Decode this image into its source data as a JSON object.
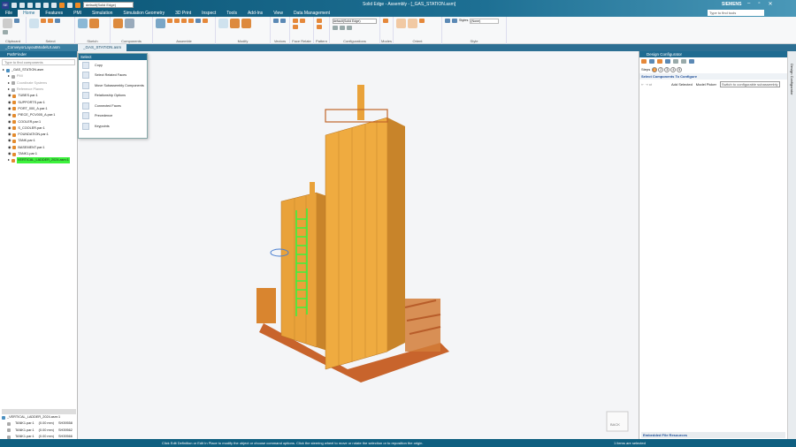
{
  "app": {
    "title": "Solid Edge - Assembly - [_GAS_STATION.asm]",
    "brand": "SIEMENS",
    "logo": "SE",
    "style_select": "default(Solid Edge)",
    "find_placeholder": "Type to find tools"
  },
  "menu_tabs": [
    "File",
    "Home",
    "Features",
    "PMI",
    "Simulation",
    "Simulation Geometry",
    "3D Print",
    "Inspect",
    "Tools",
    "Add-Ins",
    "View",
    "Data Management"
  ],
  "ribbon": {
    "groups": [
      {
        "label": "Clipboard",
        "buttons": [
          "Paste"
        ]
      },
      {
        "label": "Select",
        "buttons": [
          "Select"
        ]
      },
      {
        "label": "Sketch",
        "buttons": [
          "Sketch",
          "3D Sketch"
        ]
      },
      {
        "label": "Components",
        "buttons": [
          "Insert Component",
          "Create Part In-Place"
        ]
      },
      {
        "label": "Assemble",
        "buttons": [
          "Assemble"
        ]
      },
      {
        "label": "Modify",
        "buttons": [
          "Move on Select",
          "Drag Component",
          "Replace Part"
        ]
      },
      {
        "label": "Vectors",
        "buttons": []
      },
      {
        "label": "Face Relate",
        "buttons": []
      },
      {
        "label": "Pattern",
        "buttons": []
      },
      {
        "label": "Configurations",
        "buttons": [],
        "select": "default(Solid Edge)"
      },
      {
        "label": "Modes",
        "buttons": []
      },
      {
        "label": "Orient",
        "buttons": [
          "Zoom Area",
          "Fit"
        ]
      },
      {
        "label": "Style",
        "buttons": [
          "Styles"
        ],
        "select": "(None)"
      }
    ]
  },
  "doc_tabs": [
    {
      "label": "_ConveyorLayoutModelUI.asm",
      "active": false
    },
    {
      "label": "_GAS_STATION.asm",
      "active": true
    }
  ],
  "pathfinder": {
    "title": "PathFinder",
    "search_placeholder": "Type to find components",
    "root": "_GAS_STATION.asm",
    "items": [
      "PMI",
      "Coordinate Systems",
      "Reference Planes",
      "TUBES.par:1",
      "SUPPORTS.par:1",
      "PORT_000_A.par:1",
      "PIECE_PCV005_A.par:1",
      "COOLER.par:1",
      "S_COOLER.par:1",
      "FOUNDATION.par:1",
      "TANK.par:1",
      "BASEMENT.par:1",
      "TANK1.par:1",
      "VERTICAL_LADDER_2024.asm:1"
    ],
    "selected": "VERTICAL_LADDER_2024.asm:1",
    "lower_root": "_VERTICAL_LADDER_2024.asm:1",
    "lower_rows": [
      [
        "TANK1.par:1",
        "(0.00 mm)",
        "SH39558"
      ],
      [
        "TANK1.par:1",
        "(0.00 mm)",
        "SH39562"
      ],
      [
        "TANK1.par:1",
        "(0.00 mm)",
        "SH39566"
      ]
    ]
  },
  "select_popup": {
    "title": "Select",
    "items": [
      "Copy",
      "Select Related Faces",
      "Move Subassembly Components",
      "Relationship Options",
      "Connected Faces",
      "Precedence",
      "Keypoints"
    ]
  },
  "design_configurator": {
    "title": "Design Configurator",
    "steps_label": "Steps",
    "steps": [
      "1",
      "2",
      "3",
      "4",
      "5"
    ],
    "section": "Select Components To Configure",
    "add_selected": "Add Selected",
    "model_picker": "Model Picker",
    "tooltip": "Switch to configurable subassembly",
    "footer": "Embedded File Resources"
  },
  "side_tab": "Design Configurator",
  "viewcube": "BACK",
  "status": {
    "message": "Click Edit Definition or Edit In Place to modify the object or choose command options. Click the steering wheel to move or rotate the selection or to reposition the origin.",
    "selection": "1 items are selected"
  },
  "colors": {
    "title_bar": "#0b5575",
    "status_bar": "#0f5f80",
    "model": "#e9a23a",
    "highlight": "#3df23d"
  }
}
